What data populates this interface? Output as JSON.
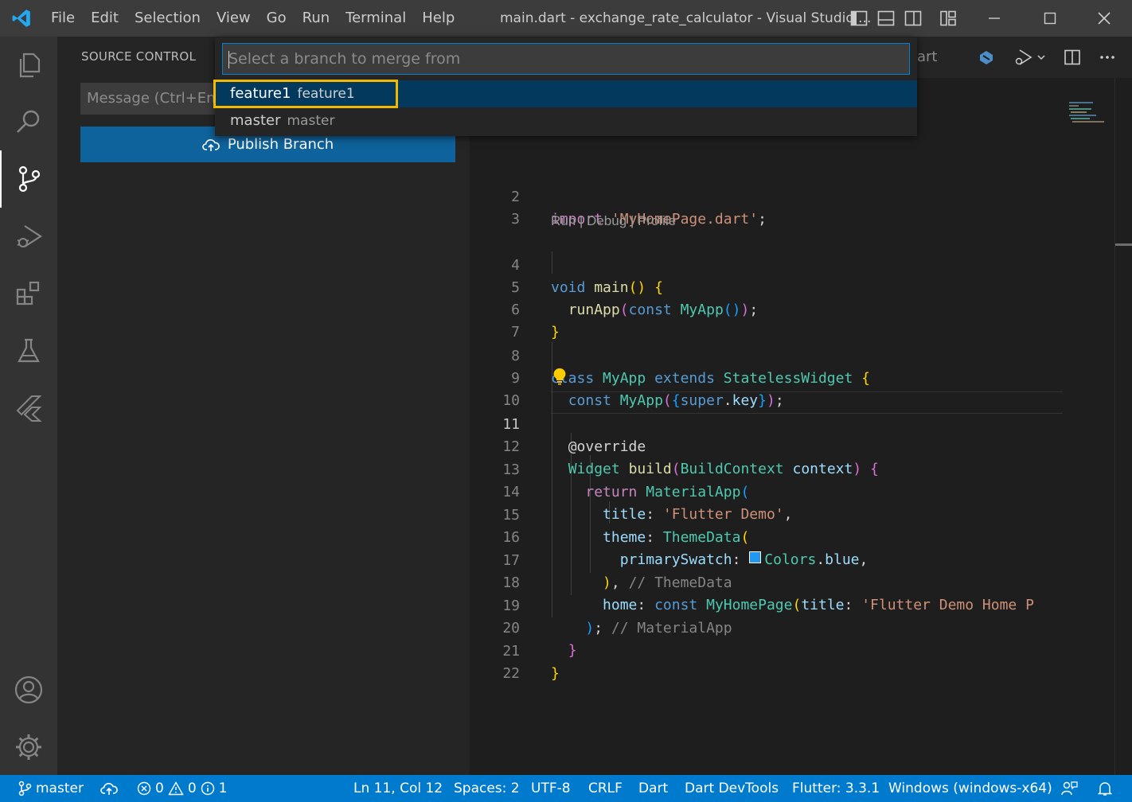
{
  "app": {
    "menu": [
      "File",
      "Edit",
      "Selection",
      "View",
      "Go",
      "Run",
      "Terminal",
      "Help"
    ],
    "window_title": "main.dart - exchange_rate_calculator - Visual Studio ..."
  },
  "activity_bar": {
    "items": [
      "Explorer",
      "Search",
      "Source Control",
      "Run and Debug",
      "Extensions",
      "Testing",
      "Flutter",
      "Accounts",
      "Manage"
    ],
    "active": "Source Control"
  },
  "sidebar": {
    "title": "SOURCE CONTROL",
    "commit_placeholder": "Message (Ctrl+Ent",
    "publish_label": "Publish Branch"
  },
  "editor": {
    "tab_fragment": "art",
    "codelens": "Run | Debug | Profile",
    "current_line": 11,
    "lines": [
      {
        "n": "2",
        "text": "import 'MyHomePage.dart';"
      },
      {
        "n": "3",
        "text": ""
      },
      {
        "n": "4",
        "text": "void main() {"
      },
      {
        "n": "5",
        "text": "  runApp(const MyApp());"
      },
      {
        "n": "6",
        "text": "}"
      },
      {
        "n": "7",
        "text": ""
      },
      {
        "n": "8",
        "text": "class MyApp extends StatelessWidget {"
      },
      {
        "n": "9",
        "text": "  const MyApp({super.key});"
      },
      {
        "n": "10",
        "text": ""
      },
      {
        "n": "11",
        "text": "  @override"
      },
      {
        "n": "12",
        "text": "  Widget build(BuildContext context) {"
      },
      {
        "n": "13",
        "text": "    return MaterialApp("
      },
      {
        "n": "14",
        "text": "      title: 'Flutter Demo',"
      },
      {
        "n": "15",
        "text": "      theme: ThemeData("
      },
      {
        "n": "16",
        "text": "        primarySwatch: Colors.blue,"
      },
      {
        "n": "17",
        "text": "      ), // ThemeData"
      },
      {
        "n": "18",
        "text": "      home: const MyHomePage(title: 'Flutter Demo Home P"
      },
      {
        "n": "19",
        "text": "    ); // MaterialApp"
      },
      {
        "n": "20",
        "text": "  }"
      },
      {
        "n": "21",
        "text": "}"
      },
      {
        "n": "22",
        "text": ""
      }
    ]
  },
  "quick_pick": {
    "placeholder": "Select a branch to merge from",
    "items": [
      {
        "label": "feature1",
        "description": "feature1",
        "selected": true
      },
      {
        "label": "master",
        "description": "master",
        "selected": false
      }
    ]
  },
  "statusbar": {
    "branch": "master",
    "errors": "0",
    "warnings": "0",
    "infos": "1",
    "position": "Ln 11, Col 12",
    "spaces": "Spaces: 2",
    "encoding": "UTF-8",
    "eol": "CRLF",
    "language": "Dart",
    "devtools": "Dart DevTools",
    "flutter": "Flutter: 3.3.1",
    "device": "Windows (windows-x64)"
  },
  "colors": {
    "accent": "#007acc",
    "highlight_border": "#f5b800",
    "selection": "#04395e",
    "button": "#0e639c"
  }
}
